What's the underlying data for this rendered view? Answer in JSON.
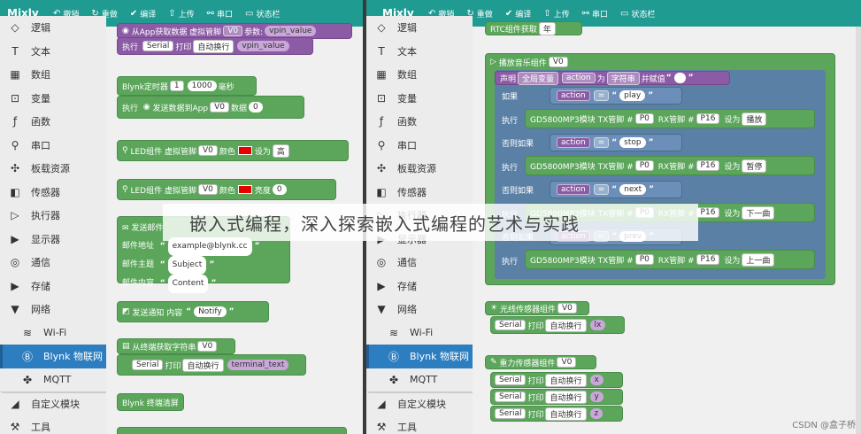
{
  "app_name": "Mixly",
  "toolbar": {
    "undo": "撤销",
    "redo": "重做",
    "compile": "编译",
    "upload": "上传",
    "serial": "串口",
    "status": "状态栏"
  },
  "categories": [
    {
      "icon": "logic-icon",
      "glyph": "◇",
      "label": "逻辑"
    },
    {
      "icon": "text-icon",
      "glyph": "T",
      "label": "文本"
    },
    {
      "icon": "array-icon",
      "glyph": "▦",
      "label": "数组"
    },
    {
      "icon": "variable-icon",
      "glyph": "⊡",
      "label": "变量"
    },
    {
      "icon": "function-icon",
      "glyph": "ƒ",
      "label": "函数"
    },
    {
      "icon": "serial-icon",
      "glyph": "⚲",
      "label": "串口"
    },
    {
      "icon": "board-icon",
      "glyph": "✣",
      "label": "板载资源"
    },
    {
      "icon": "sensor-icon",
      "glyph": "◧",
      "label": "传感器"
    },
    {
      "icon": "actuator-icon",
      "glyph": "▷",
      "label": "执行器"
    },
    {
      "icon": "expand-icon",
      "glyph": "▶",
      "label": "显示器"
    },
    {
      "icon": "network-icon",
      "glyph": "◎",
      "label": "通信"
    },
    {
      "icon": "expand-icon",
      "glyph": "▶",
      "label": "存储"
    },
    {
      "icon": "collapse-icon",
      "glyph": "▼",
      "label": "网络"
    },
    {
      "icon": "wifi-icon",
      "glyph": "≋",
      "label": "Wi-Fi",
      "sub": true
    },
    {
      "icon": "blynk-icon",
      "glyph": "Ⓑ",
      "label": "Blynk 物联网",
      "sub": true,
      "selected": true
    },
    {
      "icon": "mqtt-icon",
      "glyph": "✤",
      "label": "MQTT",
      "sub": true
    },
    {
      "icon": "custom-module-icon",
      "glyph": "◢",
      "label": "自定义模块",
      "sep": true
    },
    {
      "icon": "tools-icon",
      "glyph": "⚒",
      "label": "工具"
    }
  ],
  "left_blocks": {
    "app_get": {
      "label": "从App获取数据 虚拟管脚",
      "pin": "V0",
      "param_label": "参数:",
      "param": "vpin_value"
    },
    "exec_print": {
      "exec": "执行",
      "serial": "Serial",
      "print": "打印",
      "mode": "自动换行",
      "value": "vpin_value"
    },
    "timer": {
      "label": "Blynk定时器",
      "num": "1",
      "ms": "1000",
      "unit": "毫秒",
      "exec": "执行",
      "send": "发送数据到App",
      "pin": "V0",
      "data_label": "数据",
      "data": "0"
    },
    "led1": {
      "label": "LED组件 虚拟管脚",
      "pin": "V0",
      "color_label": "颜色",
      "set": "设为",
      "value": "高"
    },
    "led2": {
      "label": "LED组件 虚拟管脚",
      "pin": "V0",
      "color_label": "颜色",
      "bright": "亮度",
      "value": "0"
    },
    "email": {
      "label": "发送邮件",
      "addr_label": "邮件地址",
      "addr": "example@blynk.cc",
      "subject_label": "邮件主题",
      "subject": "Subject",
      "content_label": "邮件内容",
      "content": "Content"
    },
    "notify": {
      "label": "发送通知 内容",
      "value": "Notify"
    },
    "terminal": {
      "label": "从终端获取字符串",
      "pin": "V0",
      "serial": "Serial",
      "print": "打印",
      "mode": "自动换行",
      "value": "terminal_text"
    },
    "clear": {
      "label": "Blynk 终端清屏"
    }
  },
  "right_blocks": {
    "rtc": {
      "label": "RTC组件获取",
      "pin": "年"
    },
    "music": {
      "label": "播放音乐组件",
      "pin": "V0",
      "declare": "声明",
      "scope": "全局变量",
      "var": "action",
      "as": "为",
      "type": "字符串",
      "assign": "并赋值"
    },
    "if_label": "如果",
    "elseif_label": "否则如果",
    "exec": "执行",
    "eq": "=",
    "conds": [
      "play",
      "stop",
      "next",
      "prev"
    ],
    "mp3": {
      "module": "GD5800MP3模块",
      "tx": "TX管脚 #",
      "tx_pin": "P0",
      "rx": "RX管脚 #",
      "rx_pin": "P16",
      "set": "设为"
    },
    "actions": [
      "播放",
      "暂停",
      "下一曲",
      "上一曲"
    ],
    "light": {
      "label": "光线传感器组件",
      "pin": "V0",
      "serial": "Serial",
      "print": "打印",
      "mode": "自动换行",
      "value": "lx"
    },
    "gravity": {
      "label": "重力传感器组件",
      "pin": "V0",
      "serial": "Serial",
      "print": "打印",
      "mode": "自动换行",
      "values": [
        "x",
        "y",
        "z"
      ]
    }
  },
  "overlay_text": "嵌入式编程，深入探索嵌入式编程的艺术与实践",
  "watermark": "CSDN @盒子桥",
  "colors": {
    "topbar": "#1f9b92",
    "selected": "#2c7ec0",
    "led": "#e60000"
  }
}
